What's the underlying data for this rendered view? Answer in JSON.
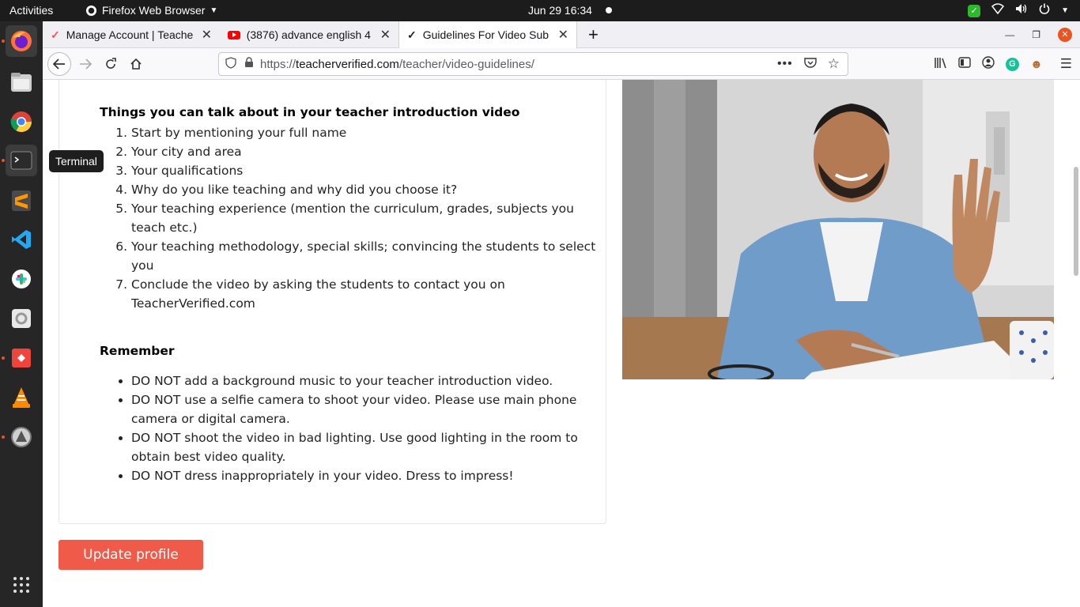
{
  "topbar": {
    "activities": "Activities",
    "app_name": "Firefox Web Browser",
    "clock": "Jun 29  16:34"
  },
  "dock": {
    "tooltip": "Terminal",
    "apps": [
      "firefox",
      "files",
      "chrome",
      "terminal",
      "sublime-text",
      "vscode",
      "slack",
      "settings",
      "anydesk",
      "vlc",
      "software-updater",
      "show-applications"
    ]
  },
  "browser": {
    "tabs": [
      {
        "title": "Manage Account | Teache"
      },
      {
        "title": "(3876) advance english 4"
      },
      {
        "title": "Guidelines For Video Sub"
      }
    ],
    "url": {
      "scheme": "https://",
      "domain": "teacherverified.com",
      "path": "/teacher/video-guidelines/"
    }
  },
  "page": {
    "talk_title": "Things you can talk about in your teacher introduction video",
    "talk_items": [
      "Start by mentioning your full name",
      "Your city and area",
      "Your qualifications",
      "Why do you like teaching and why did you choose it?",
      "Your teaching experience (mention the curriculum, grades, subjects you teach etc.)",
      "Your teaching methodology, special skills; convincing the students to select you",
      "Conclude the video by asking the students to contact you on TeacherVerified.com"
    ],
    "remember_title": "Remember",
    "remember_items": [
      "DO NOT add a background music to your teacher introduction video.",
      "DO NOT use a selfie camera to shoot your video. Please use main phone camera or digital camera.",
      "DO NOT shoot the video in bad lighting. Use good lighting in the room to obtain best video quality.",
      "DO NOT dress inappropriately in your video. Dress to impress!"
    ],
    "update_button": "Update profile"
  },
  "colors": {
    "accent": "#f05a49",
    "ubuntu_orange": "#e95420"
  }
}
